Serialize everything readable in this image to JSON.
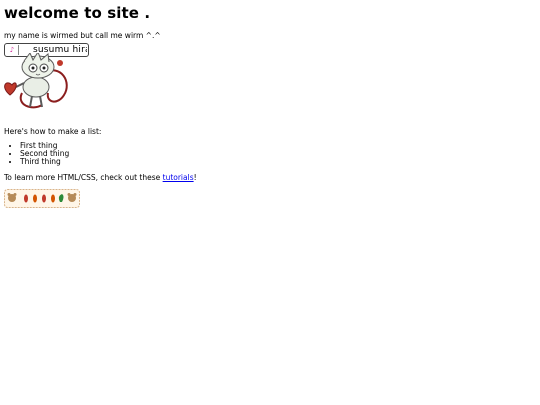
{
  "page": {
    "heading": "welcome to site .",
    "intro": "my name is wirmed but call me wirm ^.^"
  },
  "player": {
    "play_icon": "music-note-icon",
    "play_glyph": "♪",
    "track_text": "susumu hiras"
  },
  "list_section": {
    "intro": "Here's how to make a list:",
    "items": [
      "First thing",
      "Second thing",
      "Third thing"
    ]
  },
  "learn_more": {
    "prefix": "To learn more HTML/CSS, check out these ",
    "link_text": "tutorials",
    "suffix": "!"
  },
  "colors": {
    "link": "#0000ee",
    "player_icon": "#d0309a",
    "stamp_border": "#d9b48a",
    "stamp_bg": "#fff6e8"
  }
}
